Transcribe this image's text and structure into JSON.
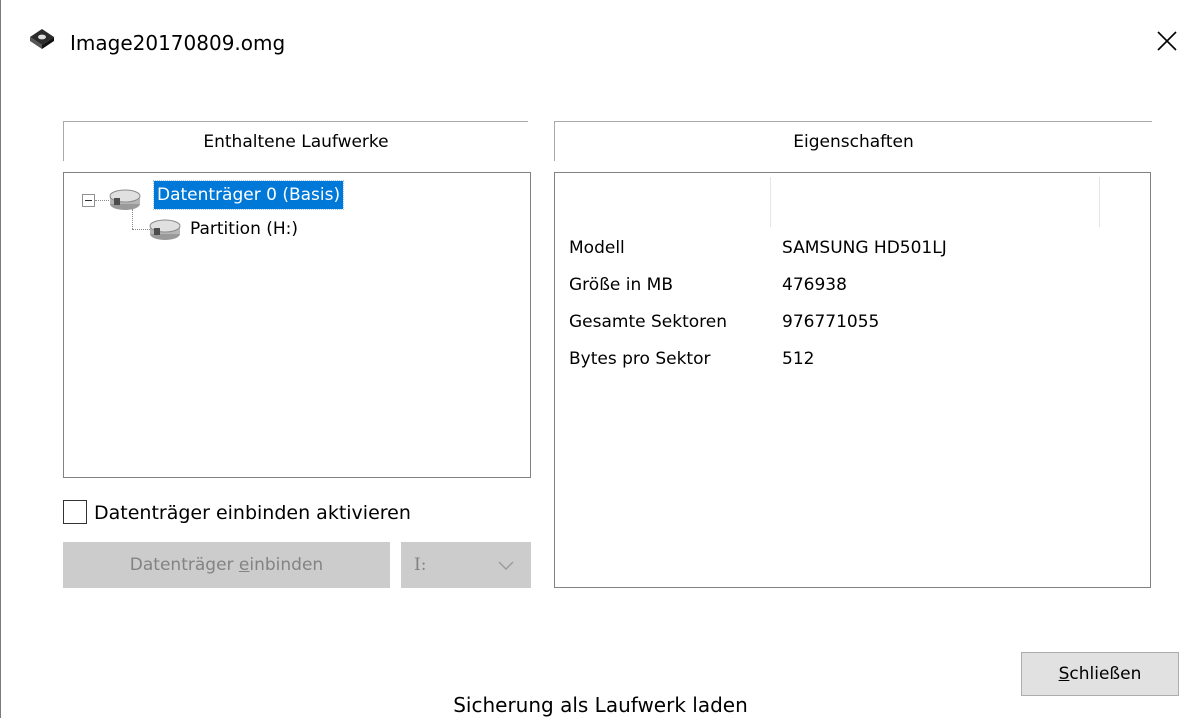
{
  "window": {
    "title": "Image20170809.omg",
    "close_icon": "close-icon",
    "app_icon": "disk-image-icon"
  },
  "left_section": {
    "header": "Enthaltene Laufwerke",
    "tree": [
      {
        "label": "Datenträger 0 (Basis)",
        "selected": true,
        "expanded": true,
        "icon": "hard-disk-icon"
      },
      {
        "label": "Partition (H:)",
        "selected": false,
        "icon": "hard-disk-icon"
      }
    ],
    "checkbox": {
      "label": "Datenträger einbinden aktivieren",
      "checked": false
    },
    "mount_button": {
      "label_pre": "Datenträger ",
      "label_mnemonic": "e",
      "label_post": "inbinden",
      "enabled": false
    },
    "drive_select": {
      "value": "I:",
      "enabled": false
    }
  },
  "right_section": {
    "header": "Eigenschaften",
    "properties": [
      {
        "key": "Modell",
        "value": "SAMSUNG HD501LJ"
      },
      {
        "key": "Größe in MB",
        "value": "476938"
      },
      {
        "key": "Gesamte Sektoren",
        "value": "976771055"
      },
      {
        "key": "Bytes pro Sektor",
        "value": "512"
      }
    ]
  },
  "footer": {
    "close_button": {
      "mnemonic": "S",
      "label_rest": "chließen"
    },
    "caption": "Sicherung als Laufwerk laden"
  },
  "colors": {
    "selection": "#0078d7",
    "disabled_bg": "#cccccc",
    "disabled_text": "#838383",
    "button_bg": "#e1e1e1"
  }
}
